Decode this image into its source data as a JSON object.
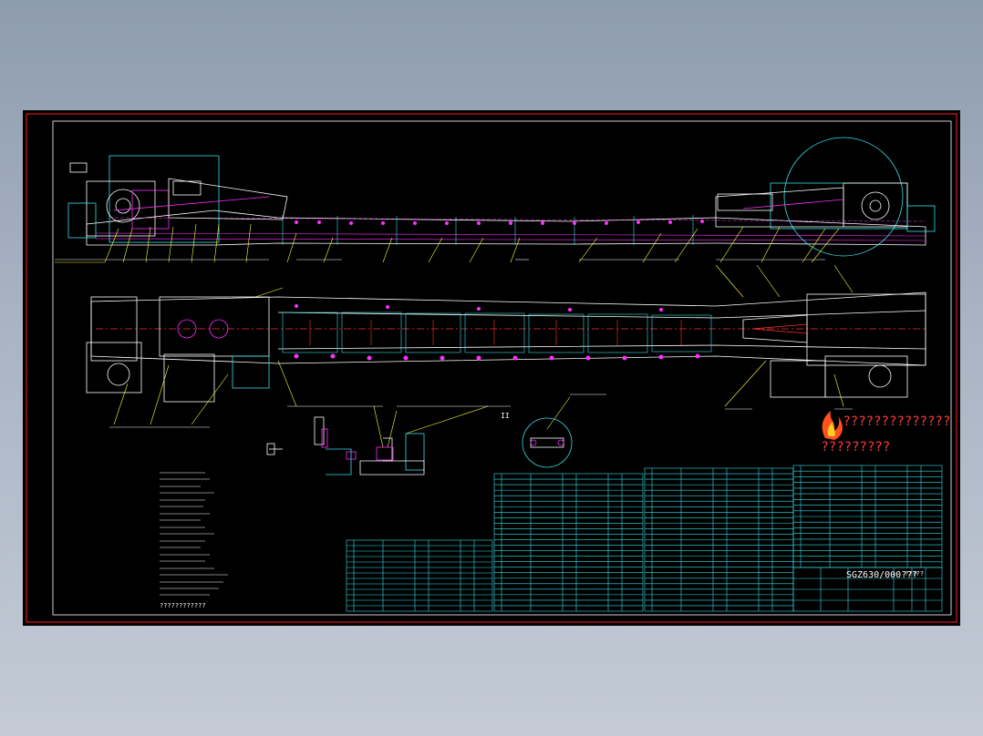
{
  "viewer": {
    "background_color": "#9aa6b8",
    "sheet_color": "#000000"
  },
  "drawing": {
    "watermark_line1": "??????????????",
    "watermark_line2": "?????????",
    "title_block_code": "SGZ630/000???",
    "title_block_small_label": "?????",
    "notes_bottom": "????????????",
    "detail_label": "II",
    "colors": {
      "frame_red": "#ff2020",
      "outline_white": "#ffffff",
      "table_cyan": "#35e0e8",
      "part_magenta": "#ff30ff",
      "leader_yellow": "#ffff30",
      "center_red": "#ff3030"
    }
  }
}
